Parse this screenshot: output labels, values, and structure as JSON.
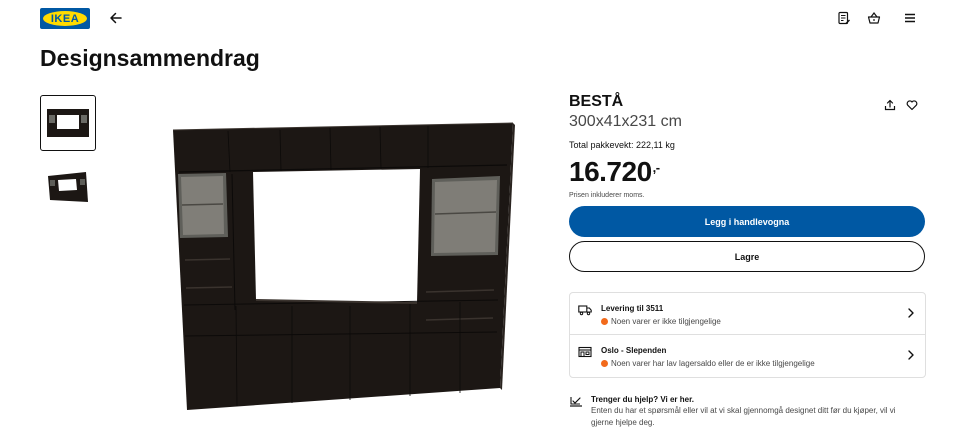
{
  "header": {
    "logo_text": "IKEA",
    "back_icon": "arrow-left-icon",
    "icons": [
      "shopping-list-icon",
      "basket-icon",
      "menu-icon"
    ]
  },
  "page": {
    "title": "Designsammendrag"
  },
  "product": {
    "name": "BESTÅ",
    "dimensions": "300x41x231 cm",
    "weight_label": "Total pakkevekt: 222,11 kg",
    "price": "16.720",
    "price_suffix": ",-",
    "vat_note": "Prisen inkluderer moms.",
    "add_to_cart_label": "Legg i handlevogna",
    "save_label": "Lagre"
  },
  "availability": {
    "delivery": {
      "title": "Levering til 3511",
      "status": "Noen varer er ikke tilgjengelige"
    },
    "store": {
      "title": "Oslo - Slependen",
      "status": "Noen varer har lav lagersaldo eller de er ikke tilgjengelige"
    }
  },
  "help": {
    "title": "Trenger du hjelp? Vi er her.",
    "text": "Enten du har et spørsmål eller vil at vi skal gjennomgå designet ditt før du kjøper, vil vi gjerne hjelpe deg."
  },
  "colors": {
    "brand_blue": "#0058a3",
    "brand_yellow": "#ffdb00",
    "status_orange": "#f26a1b",
    "furniture": "#1c1714"
  }
}
